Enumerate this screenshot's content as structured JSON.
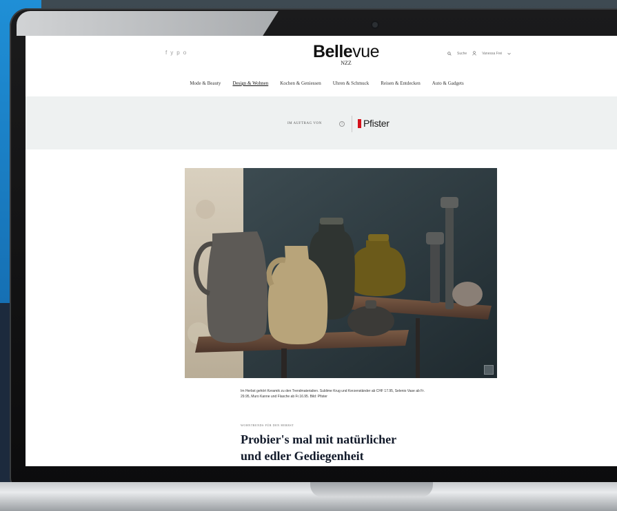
{
  "site": {
    "brand_bold": "Belle",
    "brand_light": "vue",
    "brand_sub": "NZZ",
    "social_icons": [
      "facebook-icon",
      "twitter-icon",
      "pinterest-icon",
      "instagram-icon"
    ],
    "social_glyphs": [
      "f",
      "y",
      "p",
      "o"
    ],
    "search_label": "Suche",
    "user_label": "Vanessa Frei"
  },
  "nav": {
    "items": [
      {
        "label": "Mode & Beauty",
        "active": false
      },
      {
        "label": "Design & Wohnen",
        "active": true
      },
      {
        "label": "Kochen & Geniessen",
        "active": false
      },
      {
        "label": "Uhren & Schmuck",
        "active": false
      },
      {
        "label": "Reisen & Entdecken",
        "active": false
      },
      {
        "label": "Auto & Gadgets",
        "active": false
      }
    ]
  },
  "sponsor": {
    "label": "IM AUFTRAG VON",
    "info_glyph": "i",
    "partner": "Pfister",
    "brand_color": "#d4121b"
  },
  "article": {
    "caption_text": "Im Herbst gehört Keramik zu den Trendmaterialien. Sublime Krug und Kerzenständer ab CHF 17.95, Selenio Vase ab Fr. 29.95, Muro Kanne und Flasche ab Fr.16.95. Bild: Pfister",
    "kicker": "WOHNTRENDS FÜR DEN HERBST",
    "headline_line1": "Probier's mal mit natürlicher",
    "headline_line2": "und edler Gediegenheit"
  },
  "colors": {
    "page_background": "#ffffff",
    "sponsor_band": "#eef1f1",
    "headline": "#121a2a"
  }
}
